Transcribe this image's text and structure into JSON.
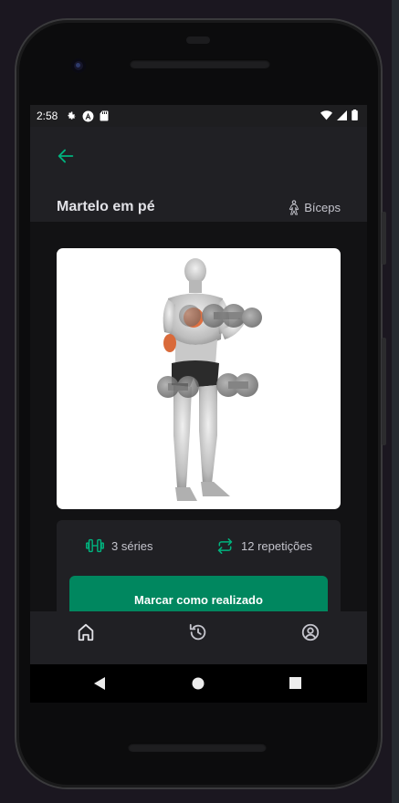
{
  "status_bar": {
    "time": "2:58",
    "left_icons": [
      "settings-icon",
      "a-icon",
      "sd-card-icon"
    ],
    "right_icons": [
      "wifi-icon",
      "signal-icon",
      "battery-icon"
    ]
  },
  "header": {
    "back_icon": "arrow-left-icon",
    "title": "Martelo em pé",
    "group_icon": "body-icon",
    "group": "Bíceps"
  },
  "exercise": {
    "image_icon": "exercise-demo-image",
    "series_icon": "dumbbell-icon",
    "series": "3 séries",
    "repetitions_icon": "repeat-icon",
    "repetitions": "12 repetições",
    "done_button": "Marcar como realizado"
  },
  "tabs": [
    {
      "icon": "home-icon"
    },
    {
      "icon": "history-icon"
    },
    {
      "icon": "profile-icon"
    }
  ],
  "system_nav": [
    "back-triangle-icon",
    "home-circle-icon",
    "recents-square-icon"
  ],
  "colors": {
    "accent": "#00b37e",
    "button": "#00875f",
    "header_bg": "#202024",
    "content_bg": "#121214",
    "text_primary": "#e1e1e6",
    "text_secondary": "#c4c4cc"
  }
}
